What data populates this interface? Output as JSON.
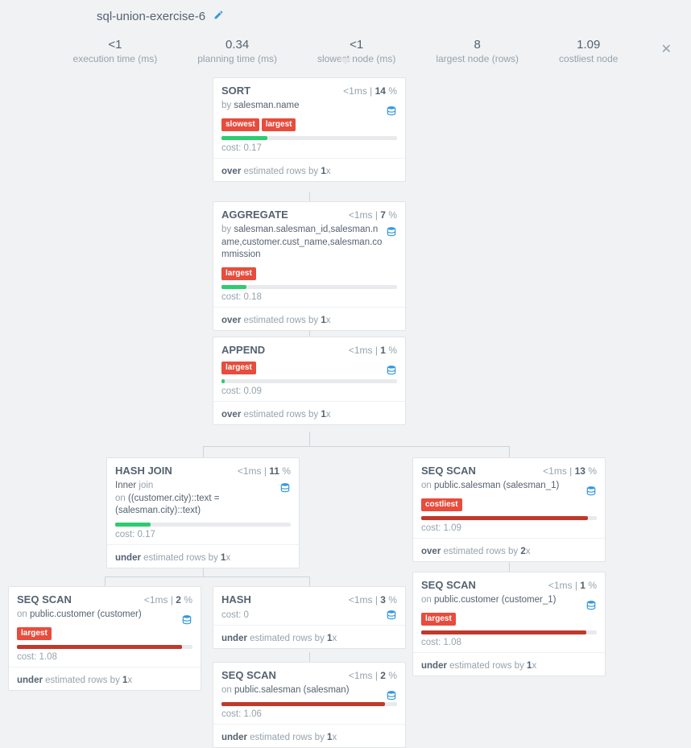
{
  "title": "sql-union-exercise-6",
  "stats": {
    "exec": {
      "value": "<1",
      "label": "execution time (ms)"
    },
    "plan": {
      "value": "0.34",
      "label": "planning time (ms)"
    },
    "slow": {
      "value": "<1",
      "label": "slowest node (ms)"
    },
    "largest": {
      "value": "8",
      "label": "largest node (rows)"
    },
    "cost": {
      "value": "1.09",
      "label": "costliest node"
    }
  },
  "nodes": {
    "sort": {
      "name": "SORT",
      "time": "<1ms",
      "pct": "14",
      "by_prefix": "by ",
      "by": "salesman.name",
      "tags": [
        "slowest",
        "largest"
      ],
      "bar_w": "26%",
      "bar_class": "bar-green",
      "cost": "cost: 0.17",
      "est_b": "over",
      "est_rest": " estimated rows by ",
      "est_x": "1"
    },
    "agg": {
      "name": "AGGREGATE",
      "time": "<1ms",
      "pct": "7",
      "by_prefix": "by ",
      "by": "salesman.salesman_id,salesman.name,customer.cust_name,salesman.commission",
      "tags": [
        "largest"
      ],
      "bar_w": "14%",
      "bar_class": "bar-green",
      "cost": "cost: 0.18",
      "est_b": "over",
      "est_rest": " estimated rows by ",
      "est_x": "1"
    },
    "append": {
      "name": "APPEND",
      "time": "<1ms",
      "pct": "1",
      "tags": [
        "largest"
      ],
      "bar_w": "2%",
      "bar_class": "bar-green",
      "cost": "cost: 0.09",
      "est_b": "over",
      "est_rest": " estimated rows by ",
      "est_x": "1"
    },
    "hashjoin": {
      "name": "HASH JOIN",
      "time": "<1ms",
      "pct": "11",
      "sub_a": "Inner ",
      "sub_a2": "join",
      "sub_b": "on ",
      "sub_b2": "((customer.city)::text = (salesman.city)::text)",
      "bar_w": "20%",
      "bar_class": "bar-green",
      "cost": "cost: 0.17",
      "est_b": "under",
      "est_rest": " estimated rows by ",
      "est_x": "1"
    },
    "seqscan_salesman1": {
      "name": "SEQ SCAN",
      "time": "<1ms",
      "pct": "13",
      "on_prefix": "on ",
      "on": "public.salesman (salesman_1)",
      "tags": [
        "costliest"
      ],
      "bar_w": "95%",
      "bar_class": "bar-red",
      "cost": "cost: 1.09",
      "est_b": "over",
      "est_rest": " estimated rows by ",
      "est_x": "2"
    },
    "seqscan_cust": {
      "name": "SEQ SCAN",
      "time": "<1ms",
      "pct": "2",
      "on_prefix": "on ",
      "on": "public.customer (customer)",
      "tags": [
        "largest"
      ],
      "bar_w": "94%",
      "bar_class": "bar-red",
      "cost": "cost: 1.08",
      "est_b": "under",
      "est_rest": " estimated rows by ",
      "est_x": "1"
    },
    "hash": {
      "name": "HASH",
      "time": "<1ms",
      "pct": "3",
      "bar_w": "0%",
      "bar_class": "bar-green",
      "cost": "cost: 0",
      "est_b": "under",
      "est_rest": " estimated rows by ",
      "est_x": "1"
    },
    "seqscan_customer1": {
      "name": "SEQ SCAN",
      "time": "<1ms",
      "pct": "1",
      "on_prefix": "on ",
      "on": "public.customer (customer_1)",
      "tags": [
        "largest"
      ],
      "bar_w": "94%",
      "bar_class": "bar-red",
      "cost": "cost: 1.08",
      "est_b": "under",
      "est_rest": " estimated rows by ",
      "est_x": "1"
    },
    "seqscan_salesman": {
      "name": "SEQ SCAN",
      "time": "<1ms",
      "pct": "2",
      "on_prefix": "on ",
      "on": "public.salesman (salesman)",
      "bar_w": "93%",
      "bar_class": "bar-red",
      "cost": "cost: 1.06",
      "est_b": "under",
      "est_rest": " estimated rows by ",
      "est_x": "1"
    }
  },
  "labels": {
    "pct_suffix": " %",
    "x_suffix": "x"
  }
}
